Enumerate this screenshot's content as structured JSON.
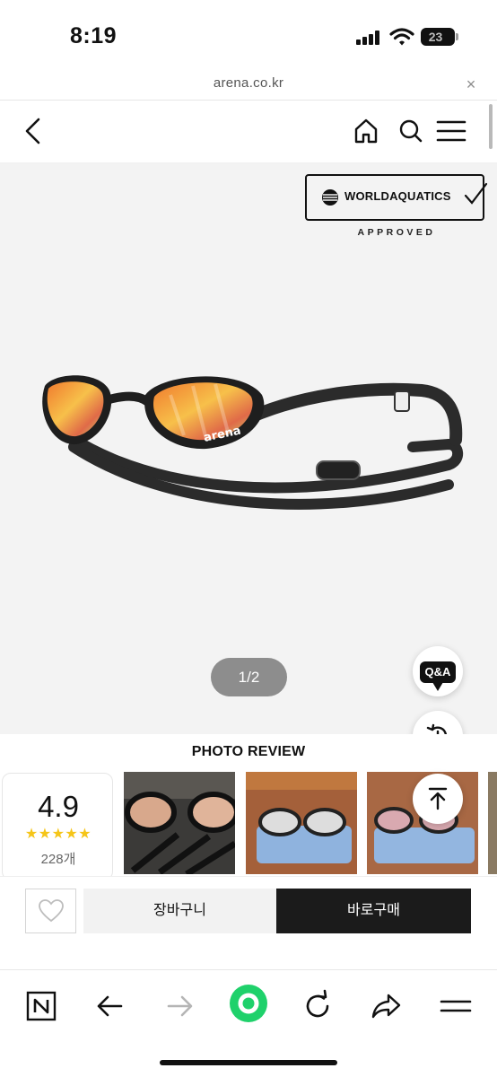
{
  "status_bar": {
    "time": "8:19",
    "battery": "23"
  },
  "url_bar": {
    "url": "arena.co.kr",
    "close_glyph": "×"
  },
  "header": {
    "back_icon": "chevron-left-icon",
    "home_icon": "home-icon",
    "search_icon": "search-icon",
    "menu_icon": "hamburger-menu-icon"
  },
  "product": {
    "badge_text": "WORLDAQUATICS",
    "badge_sub": "APPROVED",
    "lens_brand": "arena",
    "pager": "1/2"
  },
  "floating": {
    "qa_label": "Q&A",
    "recent_icon": "history-icon",
    "top_icon": "arrow-up-to-top-icon"
  },
  "photo_review": {
    "title": "PHOTO REVIEW",
    "score": "4.9",
    "stars": "★★★★★",
    "count": "228개"
  },
  "purchase": {
    "cart_label": "장바구니",
    "buy_label": "바로구매"
  },
  "browser_toolbar": {
    "items": [
      "naver-n-icon",
      "back-arrow-icon",
      "forward-arrow-icon",
      "green-dot-icon",
      "reload-icon",
      "share-icon",
      "menu-icon"
    ]
  },
  "colors": {
    "accent_green": "#1fd16b",
    "buy_button": "#1b1b1b",
    "star": "#f5c518"
  }
}
